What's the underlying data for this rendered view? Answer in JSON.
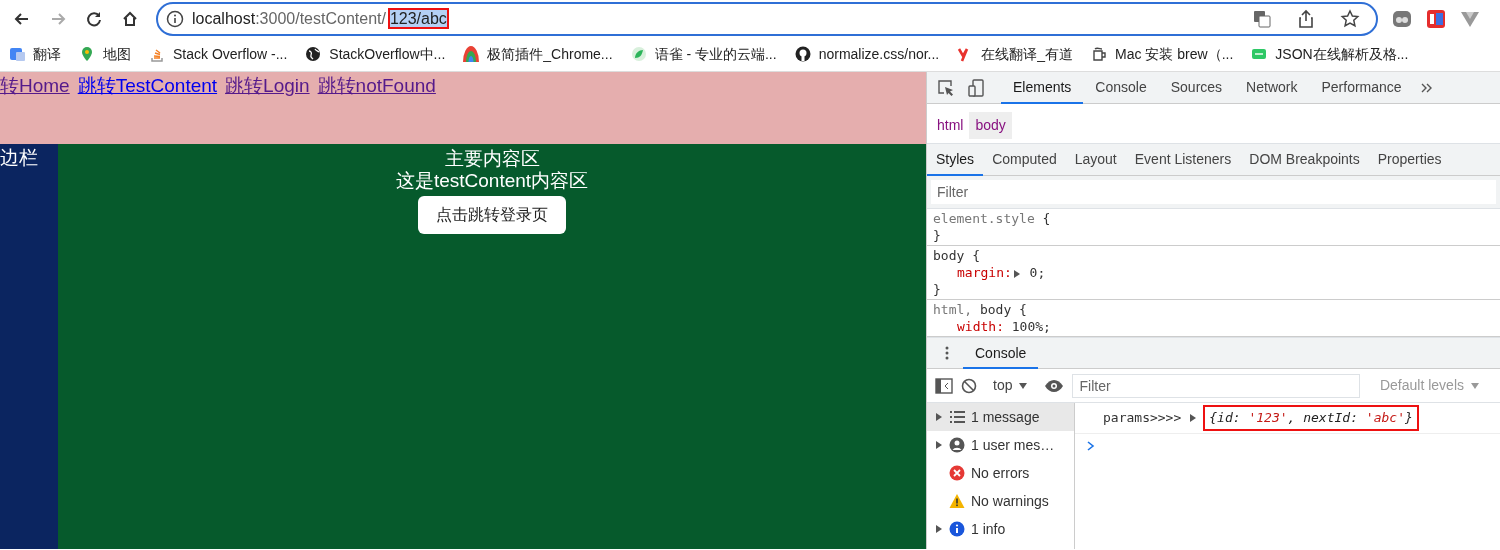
{
  "browser": {
    "nav_buttons": [
      {
        "kind": "back",
        "disabled": false
      },
      {
        "kind": "forward",
        "disabled": true
      },
      {
        "kind": "reload",
        "disabled": false
      },
      {
        "kind": "home",
        "disabled": false
      }
    ],
    "address": {
      "host": "localhost",
      "path": ":3000/testContent/",
      "selected_text": "123/abc",
      "highlighted": true
    },
    "bookmarks": [
      {
        "label": "翻译",
        "kind": "translate"
      },
      {
        "label": "地图",
        "kind": "pin"
      },
      {
        "label": "Stack Overflow -...",
        "kind": "stack"
      },
      {
        "label": "StackOverflow中...",
        "kind": "globe"
      },
      {
        "label": "极简插件_Chrome...",
        "kind": "rainbow"
      },
      {
        "label": "语雀 - 专业的云端...",
        "kind": "leaf"
      },
      {
        "label": "normalize.css/nor...",
        "kind": "github"
      },
      {
        "label": "在线翻译_有道",
        "kind": "youdao"
      },
      {
        "label": "Mac 安装 brew（...",
        "kind": "brew"
      },
      {
        "label": "JSON在线解析及格...",
        "kind": "json"
      }
    ]
  },
  "page": {
    "nav_links": [
      {
        "label": "转Home",
        "visited": true
      },
      {
        "label": "跳转TestContent",
        "visited": false
      },
      {
        "label": "跳转Login",
        "visited": true
      },
      {
        "label": "跳转notFound",
        "visited": true
      }
    ],
    "sidebar_label": "边栏",
    "main_lines": [
      "主要内容区",
      "这是testContent内容区"
    ],
    "button": "点击跳转登录页"
  },
  "devtools": {
    "tabs": [
      {
        "label": "Elements",
        "selected": true
      },
      {
        "label": "Console",
        "selected": false
      },
      {
        "label": "Sources",
        "selected": false
      },
      {
        "label": "Network",
        "selected": false
      },
      {
        "label": "Performance",
        "selected": false
      }
    ],
    "breadcrumbs": [
      {
        "label": "html",
        "selected": false
      },
      {
        "label": "body",
        "selected": true
      }
    ],
    "styles_tabs": [
      {
        "label": "Styles",
        "selected": true
      },
      {
        "label": "Computed",
        "selected": false
      },
      {
        "label": "Layout",
        "selected": false
      },
      {
        "label": "Event Listeners",
        "selected": false
      },
      {
        "label": "DOM Breakpoints",
        "selected": false
      },
      {
        "label": "Properties",
        "selected": false
      }
    ],
    "filter_placeholder": "Filter",
    "rules": [
      {
        "selectors": [
          {
            "text": "element.style",
            "matched": false
          }
        ],
        "open": "{",
        "close": "}"
      },
      {
        "selectors": [
          {
            "text": "body",
            "matched": true
          }
        ],
        "open": "{",
        "close": "}",
        "declarations": [
          {
            "property": "margin:",
            "value": "0;",
            "expandable": true
          }
        ]
      },
      {
        "selectors": [
          {
            "text": "html,",
            "matched": false
          },
          {
            "text": "body",
            "matched": true
          }
        ],
        "open": "{",
        "declarations": [
          {
            "property": "width:",
            "value": "100%;"
          }
        ]
      }
    ],
    "drawer": {
      "tab": {
        "label": "Console",
        "selected": true
      },
      "context": "top",
      "filter_placeholder": "Filter",
      "levels": "Default levels",
      "sidebar": [
        {
          "label": "1 message",
          "kind": "messages",
          "selected": true,
          "expandable": true
        },
        {
          "label": "1 user mes…",
          "kind": "user",
          "selected": false,
          "expandable": true
        },
        {
          "label": "No errors",
          "kind": "error",
          "selected": false,
          "expandable": false
        },
        {
          "label": "No warnings",
          "kind": "warning",
          "selected": false,
          "expandable": false
        },
        {
          "label": "1 info",
          "kind": "info",
          "selected": false,
          "expandable": true
        }
      ],
      "messages": [
        {
          "text": "params>>>>",
          "highlighted": true,
          "tokens": [
            {
              "text": "{id: ",
              "kind": "plain"
            },
            {
              "text": "'123'",
              "kind": "string"
            },
            {
              "text": ", nextId: ",
              "kind": "plain"
            },
            {
              "text": "'abc'",
              "kind": "string"
            },
            {
              "text": "}",
              "kind": "plain"
            }
          ]
        }
      ]
    }
  }
}
